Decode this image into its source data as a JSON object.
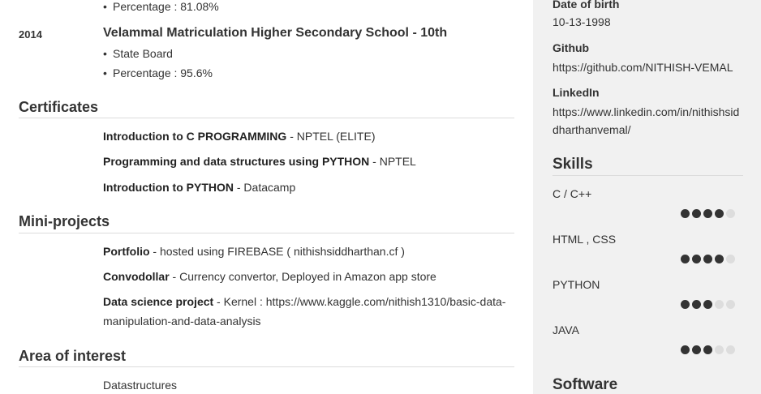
{
  "education": {
    "prev_percentage": "Percentage : 81.08%",
    "entry": {
      "year": "2014",
      "school": "Velammal Matriculation Higher Secondary School - 10th",
      "board": "State Board",
      "percentage": "Percentage : 95.6%"
    }
  },
  "certificates": {
    "title": "Certificates",
    "items": [
      {
        "name": "Introduction to C PROGRAMMING",
        "source": " - NPTEL (ELITE)"
      },
      {
        "name": "Programming and data structures using PYTHON",
        "source": " - NPTEL"
      },
      {
        "name": "Introduction to PYTHON",
        "source": " - Datacamp"
      }
    ]
  },
  "projects": {
    "title": "Mini-projects",
    "items": [
      {
        "name": "Portfolio",
        "desc": " - hosted using FIREBASE ( nithishsiddharthan.cf )"
      },
      {
        "name": "Convodollar",
        "desc": " - Currency convertor, Deployed in Amazon app store"
      },
      {
        "name": "Data science project",
        "desc": " - Kernel : https://www.kaggle.com/nithish1310/basic-data-",
        "desc2": "manipulation-and-data-analysis"
      }
    ]
  },
  "interest": {
    "title": "Area of interest",
    "items": [
      "Datastructures"
    ]
  },
  "sidebar": {
    "dob_label": "Date of birth",
    "dob_value": "10-13-1998",
    "github_label": "Github",
    "github_value": "https://github.com/NITHISH-VEMAL",
    "linkedin_label": "LinkedIn",
    "linkedin_value_1": "https://www.linkedin.com/in/nithishsid",
    "linkedin_value_2": "dharthanvemal/",
    "skills_title": "Skills",
    "skills": [
      {
        "name": "C / C++",
        "rating": 4
      },
      {
        "name": "HTML , CSS",
        "rating": 4
      },
      {
        "name": "PYTHON",
        "rating": 3
      },
      {
        "name": "JAVA",
        "rating": 3
      }
    ],
    "rating_max": 5,
    "software_title": "Software"
  }
}
